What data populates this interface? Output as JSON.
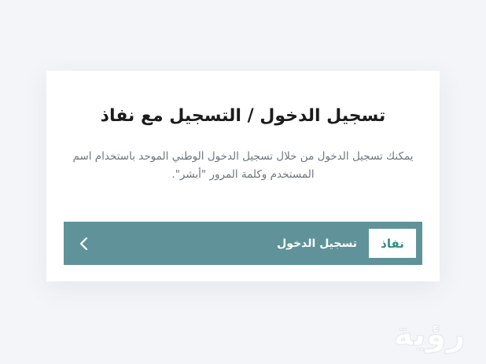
{
  "card": {
    "title": "تسجيل الدخول / التسجيل مع نفاذ",
    "description": "يمكنك تسجيل الدخول من خلال تسجيل الدخول الوطني الموحد باستخدام اسم المستخدم وكلمة المرور \"أبشر\".",
    "login_bar": {
      "badge": "نفاذ",
      "label": "تسجيل الدخول",
      "arrow_icon": "chevron-left-icon"
    }
  },
  "watermark": {
    "text": "رؤية",
    "icon": "watermark-logo"
  },
  "colors": {
    "background": "#f3f5f8",
    "card": "#ffffff",
    "login_bar": "#5f9399",
    "badge_text": "#2f8f8a"
  }
}
